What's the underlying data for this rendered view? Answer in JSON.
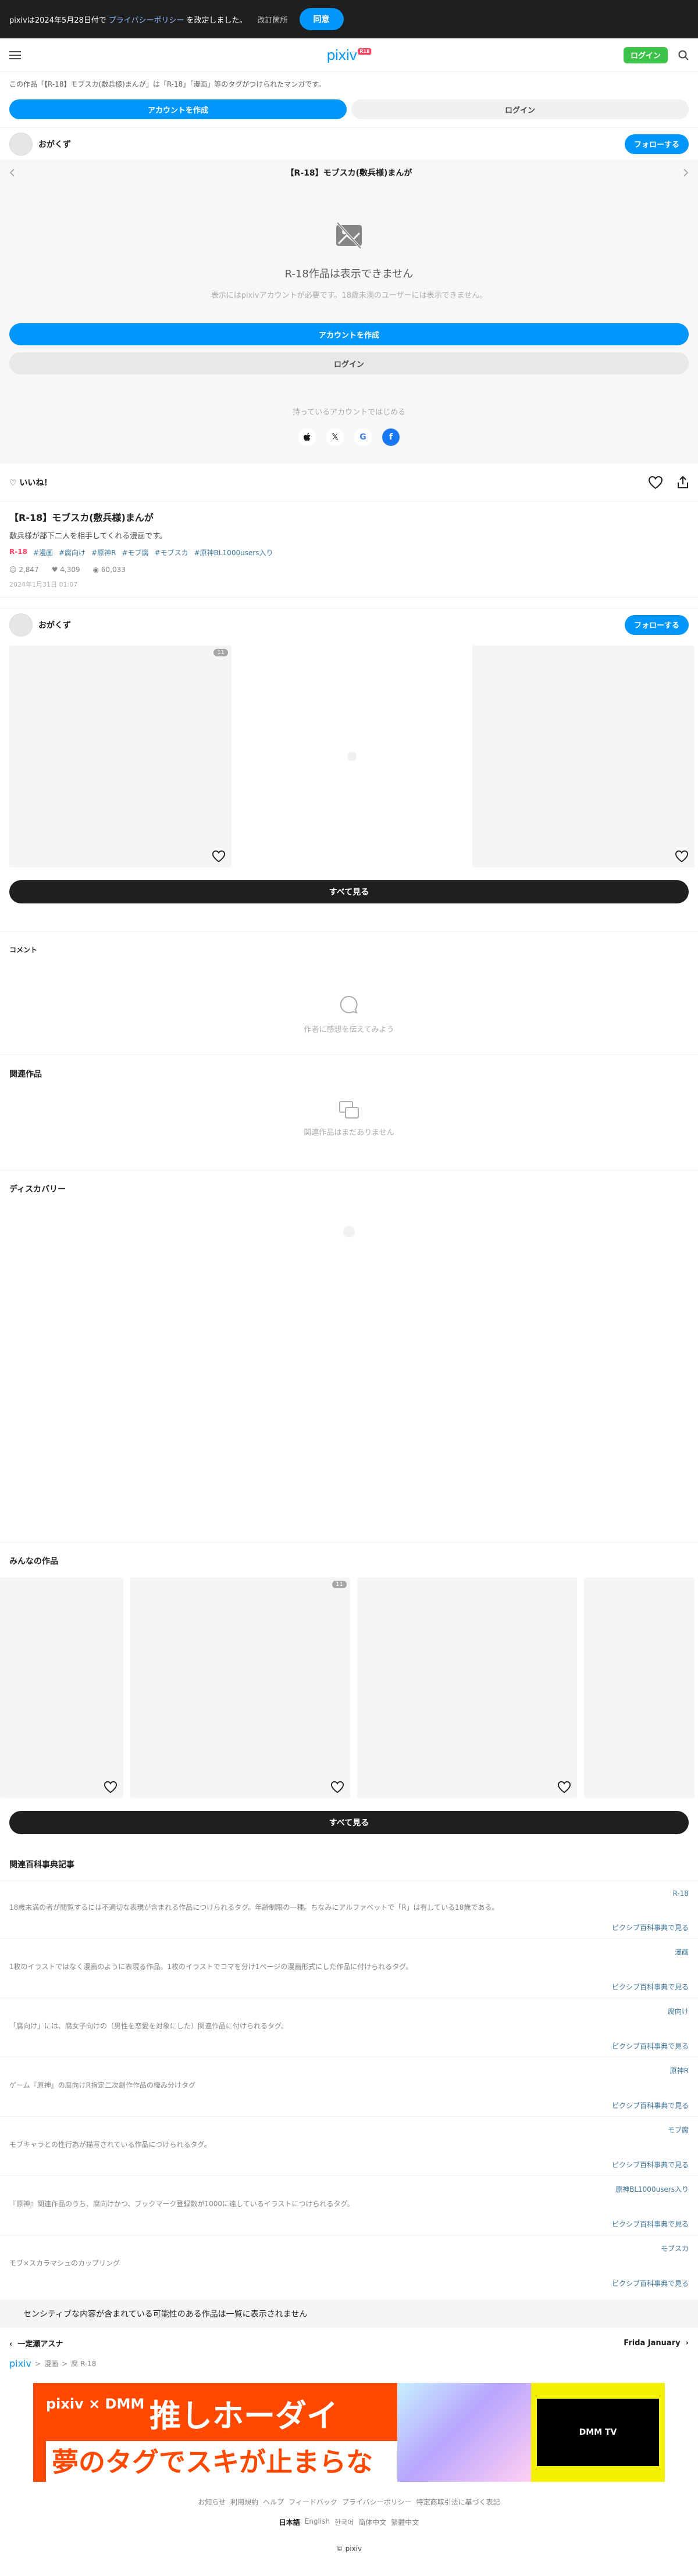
{
  "cookie": {
    "text_before": "pixivは2024年5月28日付で",
    "link": "プライバシーポリシー",
    "text_after": "を改定しました。",
    "changes": "改訂箇所",
    "agree": "同意"
  },
  "header": {
    "logo": "pixiv",
    "badge": "R18",
    "login": "ログイン"
  },
  "notice": "この作品「【R-18】モブスカ(敷兵様)まんが」は「R-18」「漫画」等のタグがつけられたマンガです。",
  "cta": {
    "create": "アカウントを作成",
    "login": "ログイン"
  },
  "author": {
    "name": "おがくず",
    "follow": "フォローする"
  },
  "artwork": {
    "title": "【R-18】モブスカ(敷兵様)まんが",
    "restricted_title": "R-18作品は表示できません",
    "restricted_sub": "表示にはpixivアカウントが必要です。18歳未満のユーザーには表示できません。",
    "create": "アカウントを作成",
    "login": "ログイン",
    "social_caption": "持っているアカウントではじめる",
    "social": [
      "",
      "𝕏",
      "G",
      "f"
    ]
  },
  "like": "いいね！",
  "meta": {
    "title": "【R-18】モブスカ(敷兵様)まんが",
    "caption": "敷兵様が部下二人を相手してくれる漫画です。",
    "r18": "R-18",
    "tags": [
      "#漫画",
      "#腐向け",
      "#原神R",
      "#モブ腐",
      "#モブスカ",
      "#原神BL1000users入り"
    ],
    "likes": "2,847",
    "bookmarks": "4,309",
    "views": "60,033",
    "date": "2024年1月31日 01:07"
  },
  "works": {
    "first_count": "11"
  },
  "see_all": "すべて見る",
  "comments": {
    "title": "コメント",
    "empty": "作者に感想を伝えてみよう"
  },
  "related": {
    "title": "関連作品",
    "empty": "関連作品はまだありません"
  },
  "discovery": {
    "title": "ディスカバリー"
  },
  "everyone": {
    "title": "みんなの作品",
    "count": "11"
  },
  "encyc": {
    "title": "関連百科事典記事",
    "more": "ピクシブ百科事典で見る",
    "items": [
      {
        "tag": "R-18",
        "desc": "18歳未満の者が閲覧するには不適切な表現が含まれる作品につけられるタグ。年齢制限の一種。ちなみにアルファベットで「R」は有している18歳である。"
      },
      {
        "tag": "漫画",
        "desc": "1枚のイラストではなく漫画のように表現る作品。1枚のイラストでコマを分け1ページの漫画形式にした作品に付けられるタグ。"
      },
      {
        "tag": "腐向け",
        "desc": "「腐向け」には、腐女子向けの（男性を恋愛を対象にした）関連作品に付けられるタグ。"
      },
      {
        "tag": "原神R",
        "desc": "ゲーム『原神』の腐向けR指定二次創作作品の棲み分けタグ"
      },
      {
        "tag": "モブ腐",
        "desc": "モブキャラとの性行為が描写されている作品につけられるタグ。"
      },
      {
        "tag": "原神BL1000users入り",
        "desc": "『原神』関連作品のうち、腐向けかつ、ブックマーク登録数が1000に達しているイラストにつけられるタグ。"
      },
      {
        "tag": "モブスカ",
        "desc": "モブ×スカラマシュのカップリング"
      }
    ]
  },
  "sensitive": "センシティブな内容が含まれている可能性のある作品は一覧に表示されません",
  "pager": {
    "prev": "一定瀬アスナ",
    "next": "Frida January"
  },
  "crumbs": [
    "pixiv",
    "漫画",
    "腐 R-18"
  ],
  "banner": {
    "brand": "pixiv × DMM",
    "main": "推しホーダイ",
    "sub": "夢のタグでスキが止まらない。",
    "tv": "DMM TV"
  },
  "footer": {
    "links": [
      "お知らせ",
      "利用規約",
      "ヘルプ",
      "フィードバック",
      "プライバシーポリシー",
      "特定商取引法に基づく表記"
    ],
    "langs": [
      "日本語",
      "English",
      "한국어",
      "简体中文",
      "繁體中文"
    ],
    "copyright": "© pixiv"
  },
  "colors": {
    "accent": "#0096fa",
    "login_green": "#3ec34a",
    "r18_red": "#ff4060",
    "tag_blue": "#3d7699",
    "dark": "#1f1f1f"
  }
}
